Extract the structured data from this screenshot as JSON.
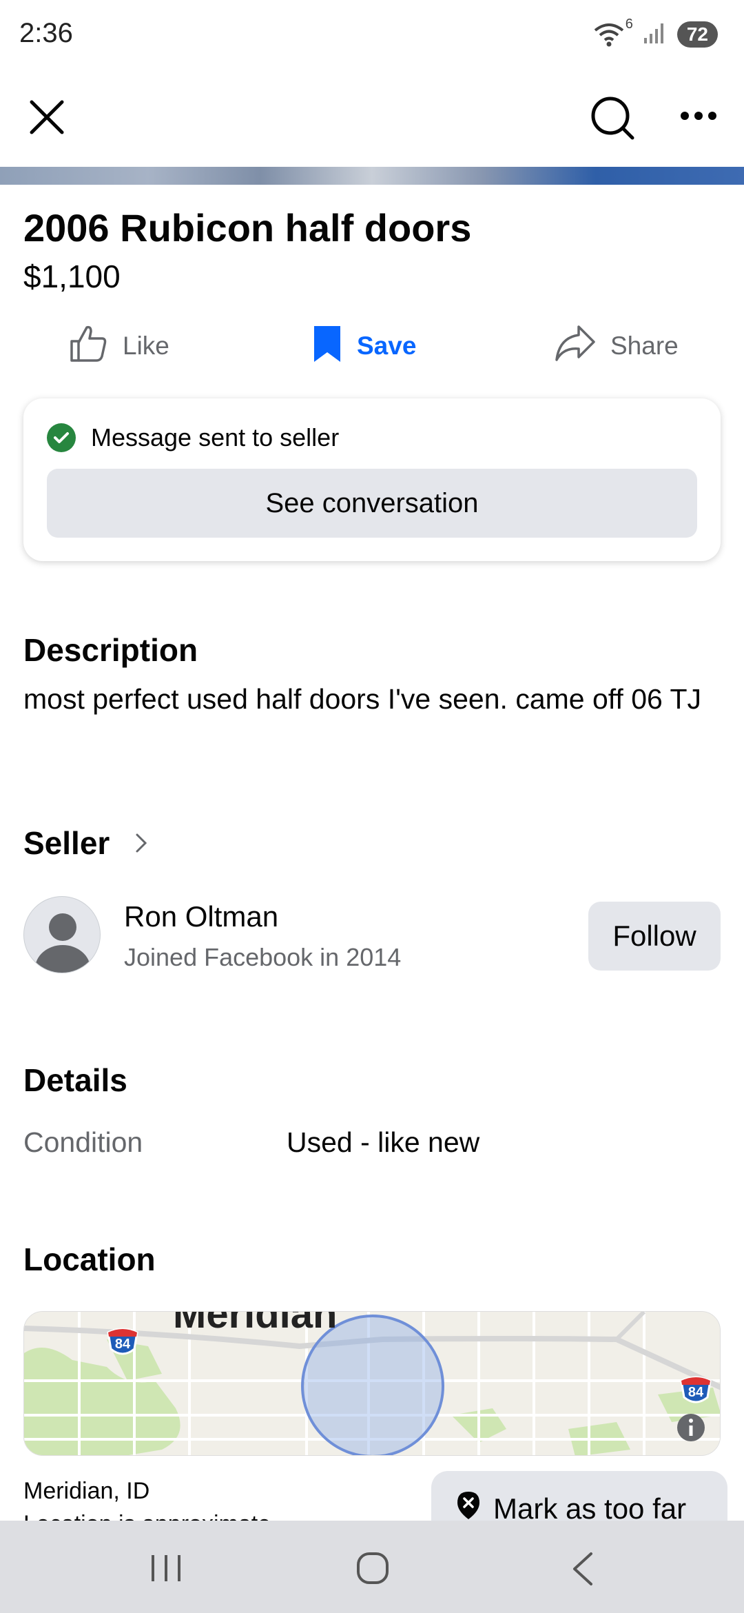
{
  "status_bar": {
    "time": "2:36",
    "wifi_badge": "6",
    "battery": "72"
  },
  "nav": {
    "close_icon": "close-icon",
    "search_icon": "search-icon",
    "more_icon": "more-icon"
  },
  "listing": {
    "title": "2006 Rubicon half doors",
    "price": "$1,100"
  },
  "actions": {
    "like": "Like",
    "save": "Save",
    "share": "Share"
  },
  "message_card": {
    "status": "Message sent to seller",
    "button": "See conversation"
  },
  "description": {
    "heading": "Description",
    "text": "most perfect used half doors I've seen.  came off 06 TJ"
  },
  "seller": {
    "heading": "Seller",
    "name": "Ron Oltman",
    "joined": "Joined Facebook in 2014",
    "follow": "Follow"
  },
  "details": {
    "heading": "Details",
    "condition_label": "Condition",
    "condition_value": "Used - like new"
  },
  "location": {
    "heading": "Location",
    "map_label": "Meridian",
    "interstate_1": "84",
    "interstate_2": "84",
    "city": "Meridian, ID",
    "sub": "Location is approximate",
    "mark_too_far": "Mark as too far"
  },
  "colors": {
    "accent": "#0866ff",
    "success": "#27863f",
    "secondary_text": "#65676b",
    "button_bg": "#e4e6eb"
  }
}
